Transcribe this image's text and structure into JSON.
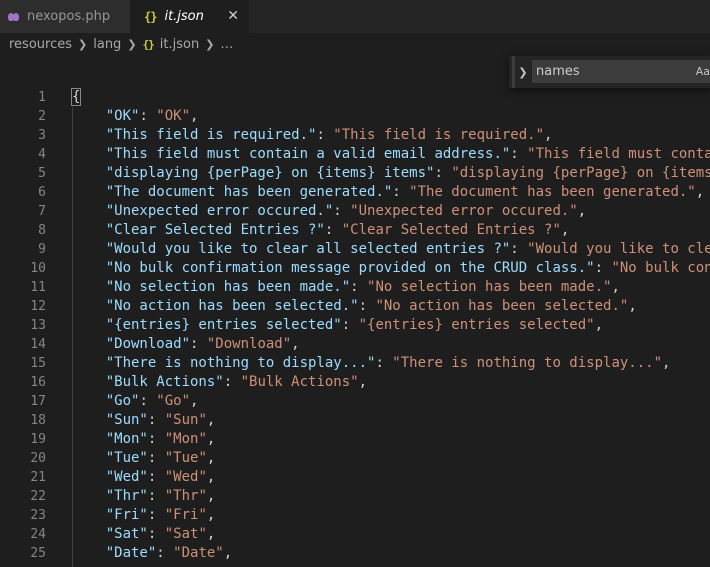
{
  "tabs": [
    {
      "label": "nexopos.php",
      "icon": "php-icon",
      "active": false
    },
    {
      "label": "it.json",
      "icon": "json-icon",
      "active": true
    }
  ],
  "json_icon_glyph": "{}",
  "close_glyph": "✕",
  "breadcrumb": [
    "resources",
    "lang",
    "it.json",
    "…"
  ],
  "find": {
    "value": "names",
    "case_label": "Aa"
  },
  "lines": [
    {
      "n": "1",
      "open": "{"
    },
    {
      "n": "2",
      "k": "\"OK\"",
      "v": "\"OK\"",
      "comma": true
    },
    {
      "n": "3",
      "k": "\"This field is required.\"",
      "v": "\"This field is required.\"",
      "comma": true
    },
    {
      "n": "4",
      "k": "\"This field must contain a valid email address.\"",
      "v": "\"This field must contain a valid email address.\"",
      "comma": true
    },
    {
      "n": "5",
      "k": "\"displaying {perPage} on {items} items\"",
      "v": "\"displaying {perPage} on {items} items\"",
      "comma": true
    },
    {
      "n": "6",
      "k": "\"The document has been generated.\"",
      "v": "\"The document has been generated.\"",
      "comma": true
    },
    {
      "n": "7",
      "k": "\"Unexpected error occured.\"",
      "v": "\"Unexpected error occured.\"",
      "comma": true
    },
    {
      "n": "8",
      "k": "\"Clear Selected Entries ?\"",
      "v": "\"Clear Selected Entries ?\"",
      "comma": true
    },
    {
      "n": "9",
      "k": "\"Would you like to clear all selected entries ?\"",
      "v": "\"Would you like to clear all selected entries ?\"",
      "comma": true
    },
    {
      "n": "10",
      "k": "\"No bulk confirmation message provided on the CRUD class.\"",
      "v": "\"No bulk confirmation message provided on the CRUD class.\"",
      "comma": true
    },
    {
      "n": "11",
      "k": "\"No selection has been made.\"",
      "v": "\"No selection has been made.\"",
      "comma": true
    },
    {
      "n": "12",
      "k": "\"No action has been selected.\"",
      "v": "\"No action has been selected.\"",
      "comma": true
    },
    {
      "n": "13",
      "k": "\"{entries} entries selected\"",
      "v": "\"{entries} entries selected\"",
      "comma": true
    },
    {
      "n": "14",
      "k": "\"Download\"",
      "v": "\"Download\"",
      "comma": true
    },
    {
      "n": "15",
      "k": "\"There is nothing to display...\"",
      "v": "\"There is nothing to display...\"",
      "comma": true
    },
    {
      "n": "16",
      "k": "\"Bulk Actions\"",
      "v": "\"Bulk Actions\"",
      "comma": true
    },
    {
      "n": "17",
      "k": "\"Go\"",
      "v": "\"Go\"",
      "comma": true
    },
    {
      "n": "18",
      "k": "\"Sun\"",
      "v": "\"Sun\"",
      "comma": true
    },
    {
      "n": "19",
      "k": "\"Mon\"",
      "v": "\"Mon\"",
      "comma": true
    },
    {
      "n": "20",
      "k": "\"Tue\"",
      "v": "\"Tue\"",
      "comma": true
    },
    {
      "n": "21",
      "k": "\"Wed\"",
      "v": "\"Wed\"",
      "comma": true
    },
    {
      "n": "22",
      "k": "\"Thr\"",
      "v": "\"Thr\"",
      "comma": true
    },
    {
      "n": "23",
      "k": "\"Fri\"",
      "v": "\"Fri\"",
      "comma": true
    },
    {
      "n": "24",
      "k": "\"Sat\"",
      "v": "\"Sat\"",
      "comma": true
    },
    {
      "n": "25",
      "k": "\"Date\"",
      "v": "\"Date\"",
      "comma": true
    }
  ],
  "colors": {
    "editor_bg": "#1e1e1e",
    "key": "#9cdcfe",
    "string_value": "#ce9178",
    "line_number": "#858585",
    "json_icon": "#cbcb41",
    "php_icon": "#a074c4"
  }
}
